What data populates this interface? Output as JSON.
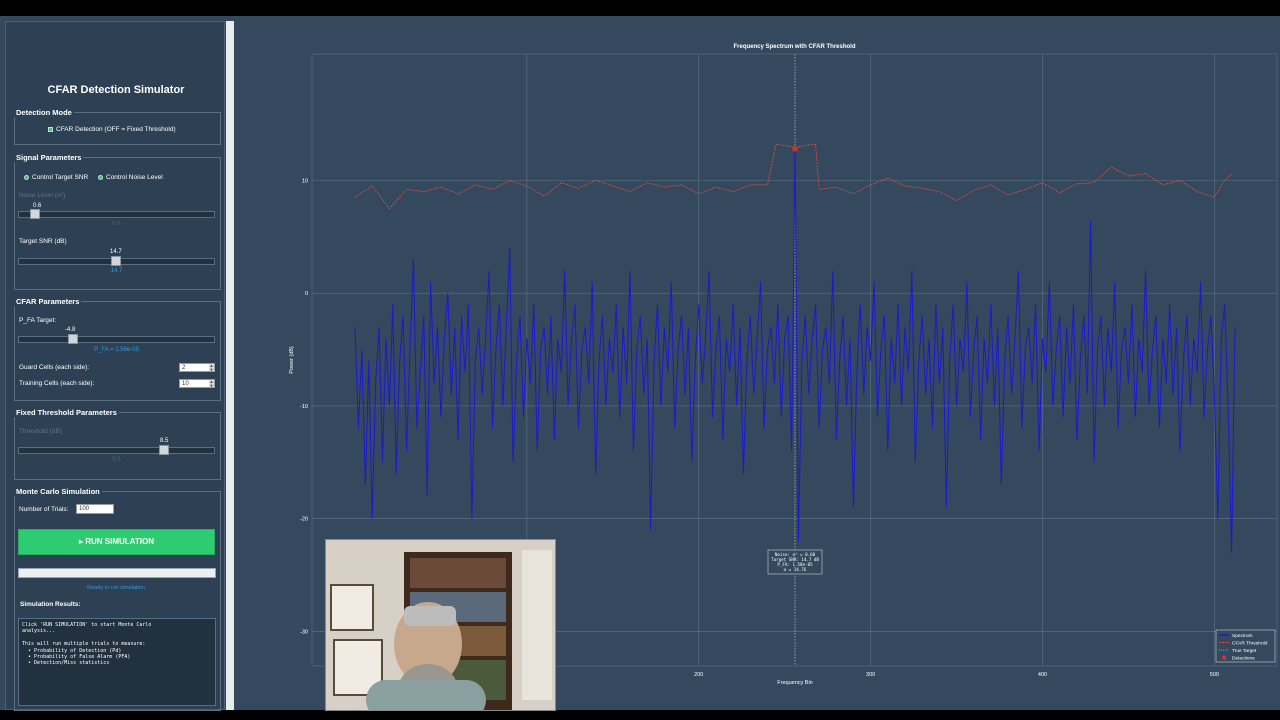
{
  "sidebar": {
    "title": "CFAR Detection Simulator",
    "detection_mode": {
      "title": "Detection Mode",
      "cfar_checkbox_label": "CFAR Detection (OFF = Fixed Threshold)",
      "cfar_checked": true
    },
    "signal": {
      "title": "Signal Parameters",
      "radio_snr_label": "Control Target SNR",
      "radio_noise_label": "Control Noise Level",
      "noise_label": "Noise Level (σ²)",
      "noise_value": "0.6",
      "noise_value_below": "0.6",
      "noise_fraction": 0.06,
      "snr_label": "Target SNR (dB)",
      "snr_value": "14.7",
      "snr_value_below": "14.7",
      "snr_fraction": 0.49
    },
    "cfar": {
      "title": "CFAR Parameters",
      "pfa_label": "P_FA Target:",
      "pfa_value": "-4.8",
      "pfa_display": "P_FA = 1.58e-05",
      "pfa_fraction": 0.26,
      "guard_label": "Guard Cells (each side):",
      "guard_value": "2",
      "training_label": "Training Cells (each side):",
      "training_value": "10"
    },
    "fixed": {
      "title": "Fixed Threshold Parameters",
      "threshold_label": "Threshold (dB)",
      "threshold_value": "8.5",
      "threshold_value_below": "8.5",
      "threshold_fraction": 0.75
    },
    "monte_carlo": {
      "title": "Monte Carlo Simulation",
      "trials_label": "Number of Trials:",
      "trials_value": "100",
      "run_label": "▸ RUN SIMULATION",
      "status": "Ready to run simulation",
      "results_title": "Simulation Results:",
      "results_text": "Click 'RUN SIMULATION' to start Monte Carlo\nanalysis...\n\nThis will run multiple trials to measure:\n  • Probability of Detection (Pd)\n  • Probability of False Alarm (PFA)\n  • Detection/Miss statistics"
    }
  },
  "chart_data": {
    "type": "line",
    "title": "Frequency Spectrum with CFAR Threshold",
    "xlabel": "Frequency Bin",
    "ylabel": "Power (dB)",
    "xlim": [
      0,
      512
    ],
    "ylim": [
      -32,
      15
    ],
    "x_ticks": [
      200,
      300,
      400,
      500
    ],
    "y_ticks": [
      10,
      0,
      -10,
      -20,
      -30
    ],
    "grid": true,
    "legend": [
      "Spectrum",
      "CFAR Threshold",
      "True Target",
      "Detections"
    ],
    "legend_position": "bottom-right",
    "true_target_bin": 256,
    "detection_bin": 256,
    "detection_value": 12.8,
    "annotation": "Noise: σ² = 0.60\nTarget SNR: 14.7 dB\nP_FA: 1.58e-05\nα = 14.76",
    "series_colors": {
      "Spectrum": "#1a1acd",
      "CFAR Threshold": "#e74c3c",
      "True Target": "#aab4be",
      "Detections": "#c0392b"
    },
    "threshold_points": [
      [
        0,
        8.5
      ],
      [
        10,
        9.5
      ],
      [
        20,
        7.5
      ],
      [
        30,
        9.2
      ],
      [
        40,
        9.0
      ],
      [
        50,
        9.4
      ],
      [
        60,
        8.8
      ],
      [
        70,
        9.6
      ],
      [
        80,
        9.2
      ],
      [
        90,
        10.0
      ],
      [
        100,
        9.5
      ],
      [
        110,
        8.6
      ],
      [
        120,
        9.8
      ],
      [
        130,
        9.3
      ],
      [
        140,
        10.0
      ],
      [
        150,
        9.5
      ],
      [
        160,
        9.0
      ],
      [
        170,
        9.8
      ],
      [
        180,
        9.4
      ],
      [
        190,
        9.6
      ],
      [
        200,
        8.8
      ],
      [
        210,
        9.4
      ],
      [
        220,
        9.0
      ],
      [
        230,
        9.6
      ],
      [
        240,
        9.6
      ],
      [
        245,
        13.2
      ],
      [
        250,
        13.1
      ],
      [
        256,
        12.9
      ],
      [
        262,
        13.1
      ],
      [
        268,
        13.2
      ],
      [
        270,
        9.2
      ],
      [
        280,
        9.4
      ],
      [
        290,
        8.8
      ],
      [
        300,
        9.6
      ],
      [
        310,
        10.2
      ],
      [
        320,
        9.5
      ],
      [
        330,
        9.3
      ],
      [
        340,
        9.0
      ],
      [
        350,
        8.2
      ],
      [
        360,
        9.1
      ],
      [
        370,
        9.6
      ],
      [
        380,
        8.7
      ],
      [
        390,
        9.2
      ],
      [
        400,
        9.8
      ],
      [
        410,
        8.9
      ],
      [
        420,
        9.7
      ],
      [
        430,
        9.8
      ],
      [
        440,
        11.2
      ],
      [
        450,
        10.4
      ],
      [
        460,
        10.6
      ],
      [
        470,
        9.6
      ],
      [
        480,
        10.0
      ],
      [
        490,
        9.0
      ],
      [
        500,
        8.5
      ],
      [
        505,
        9.8
      ],
      [
        510,
        10.6
      ]
    ],
    "spectrum_points": [
      [
        0,
        -3
      ],
      [
        2,
        -12
      ],
      [
        4,
        -5
      ],
      [
        6,
        -17
      ],
      [
        8,
        -6
      ],
      [
        10,
        -20
      ],
      [
        12,
        -8
      ],
      [
        14,
        -3
      ],
      [
        16,
        -15
      ],
      [
        18,
        -4
      ],
      [
        20,
        -10
      ],
      [
        22,
        -1
      ],
      [
        24,
        -16
      ],
      [
        26,
        -6
      ],
      [
        28,
        -2
      ],
      [
        30,
        -14
      ],
      [
        32,
        -5
      ],
      [
        34,
        3
      ],
      [
        36,
        -12
      ],
      [
        38,
        -7
      ],
      [
        40,
        -2
      ],
      [
        42,
        -18
      ],
      [
        44,
        1
      ],
      [
        46,
        -8
      ],
      [
        48,
        -3
      ],
      [
        50,
        -11
      ],
      [
        52,
        -4
      ],
      [
        54,
        0
      ],
      [
        56,
        -9
      ],
      [
        58,
        -3
      ],
      [
        60,
        -13
      ],
      [
        62,
        -2
      ],
      [
        64,
        -7
      ],
      [
        66,
        -1
      ],
      [
        68,
        -20
      ],
      [
        70,
        -6
      ],
      [
        72,
        -3
      ],
      [
        74,
        -9
      ],
      [
        76,
        -4
      ],
      [
        78,
        2
      ],
      [
        80,
        -12
      ],
      [
        82,
        -5
      ],
      [
        84,
        -1
      ],
      [
        86,
        -10
      ],
      [
        88,
        -3
      ],
      [
        90,
        4
      ],
      [
        92,
        -15
      ],
      [
        94,
        -6
      ],
      [
        96,
        -2
      ],
      [
        98,
        -11
      ],
      [
        100,
        -4
      ],
      [
        102,
        -8
      ],
      [
        104,
        -1
      ],
      [
        106,
        -14
      ],
      [
        108,
        -5
      ],
      [
        110,
        -3
      ],
      [
        112,
        -9
      ],
      [
        114,
        -2
      ],
      [
        116,
        -13
      ],
      [
        118,
        -4
      ],
      [
        120,
        -7
      ],
      [
        122,
        2
      ],
      [
        124,
        -10
      ],
      [
        126,
        -4
      ],
      [
        128,
        -1
      ],
      [
        130,
        -12
      ],
      [
        132,
        -5
      ],
      [
        134,
        -3
      ],
      [
        136,
        -8
      ],
      [
        138,
        1
      ],
      [
        140,
        -16
      ],
      [
        142,
        -6
      ],
      [
        144,
        -2
      ],
      [
        146,
        -10
      ],
      [
        148,
        -4
      ],
      [
        150,
        -7
      ],
      [
        152,
        -1
      ],
      [
        154,
        -11
      ],
      [
        156,
        -3
      ],
      [
        158,
        -8
      ],
      [
        160,
        2
      ],
      [
        162,
        -14
      ],
      [
        164,
        -5
      ],
      [
        166,
        -2
      ],
      [
        168,
        -9
      ],
      [
        170,
        -4
      ],
      [
        172,
        -21
      ],
      [
        174,
        -6
      ],
      [
        176,
        -1
      ],
      [
        178,
        -10
      ],
      [
        180,
        -3
      ],
      [
        182,
        -7
      ],
      [
        184,
        1
      ],
      [
        186,
        -12
      ],
      [
        188,
        -5
      ],
      [
        190,
        -2
      ],
      [
        192,
        -9
      ],
      [
        194,
        -3
      ],
      [
        196,
        -15
      ],
      [
        198,
        -6
      ],
      [
        200,
        -1
      ],
      [
        202,
        -8
      ],
      [
        204,
        -4
      ],
      [
        206,
        2
      ],
      [
        208,
        -11
      ],
      [
        210,
        -5
      ],
      [
        212,
        -2
      ],
      [
        214,
        -13
      ],
      [
        216,
        -4
      ],
      [
        218,
        -7
      ],
      [
        220,
        -1
      ],
      [
        222,
        -10
      ],
      [
        224,
        -3
      ],
      [
        226,
        -16
      ],
      [
        228,
        -6
      ],
      [
        230,
        -2
      ],
      [
        232,
        -9
      ],
      [
        234,
        -4
      ],
      [
        236,
        1
      ],
      [
        238,
        -12
      ],
      [
        240,
        -5
      ],
      [
        242,
        -3
      ],
      [
        244,
        -8
      ],
      [
        246,
        -1
      ],
      [
        248,
        -11
      ],
      [
        250,
        -4
      ],
      [
        252,
        -2
      ],
      [
        254,
        -14
      ],
      [
        256,
        12.8
      ],
      [
        258,
        -22
      ],
      [
        260,
        -6
      ],
      [
        262,
        -2
      ],
      [
        264,
        -9
      ],
      [
        266,
        -4
      ],
      [
        268,
        -1
      ],
      [
        270,
        -12
      ],
      [
        272,
        -5
      ],
      [
        274,
        -3
      ],
      [
        276,
        -8
      ],
      [
        278,
        2
      ],
      [
        280,
        -13
      ],
      [
        282,
        -6
      ],
      [
        284,
        -2
      ],
      [
        286,
        -10
      ],
      [
        288,
        -4
      ],
      [
        290,
        -19
      ],
      [
        292,
        -7
      ],
      [
        294,
        -1
      ],
      [
        296,
        -9
      ],
      [
        298,
        -3
      ],
      [
        300,
        -6
      ],
      [
        302,
        1
      ],
      [
        304,
        -11
      ],
      [
        306,
        -5
      ],
      [
        308,
        -2
      ],
      [
        310,
        -14
      ],
      [
        312,
        -4
      ],
      [
        314,
        -8
      ],
      [
        316,
        -1
      ],
      [
        318,
        -10
      ],
      [
        320,
        -3
      ],
      [
        322,
        -7
      ],
      [
        324,
        2
      ],
      [
        326,
        -15
      ],
      [
        328,
        -6
      ],
      [
        330,
        -2
      ],
      [
        332,
        -9
      ],
      [
        334,
        -4
      ],
      [
        336,
        -12
      ],
      [
        338,
        -1
      ],
      [
        340,
        -8
      ],
      [
        342,
        -3
      ],
      [
        344,
        -19
      ],
      [
        346,
        -6
      ],
      [
        348,
        -1
      ],
      [
        350,
        -10
      ],
      [
        352,
        -4
      ],
      [
        354,
        -7
      ],
      [
        356,
        1
      ],
      [
        358,
        -11
      ],
      [
        360,
        -5
      ],
      [
        362,
        -2
      ],
      [
        364,
        -13
      ],
      [
        366,
        -4
      ],
      [
        368,
        -8
      ],
      [
        370,
        -1
      ],
      [
        372,
        -10
      ],
      [
        374,
        -3
      ],
      [
        376,
        -17
      ],
      [
        378,
        -6
      ],
      [
        380,
        -2
      ],
      [
        382,
        -9
      ],
      [
        384,
        -4
      ],
      [
        386,
        2
      ],
      [
        388,
        -12
      ],
      [
        390,
        -5
      ],
      [
        392,
        -3
      ],
      [
        394,
        -8
      ],
      [
        396,
        -1
      ],
      [
        398,
        -14
      ],
      [
        400,
        -4
      ],
      [
        402,
        -7
      ],
      [
        404,
        1
      ],
      [
        406,
        -10
      ],
      [
        408,
        -5
      ],
      [
        410,
        -2
      ],
      [
        412,
        -11
      ],
      [
        414,
        -3
      ],
      [
        416,
        -8
      ],
      [
        418,
        -1
      ],
      [
        420,
        -13
      ],
      [
        422,
        -6
      ],
      [
        424,
        -2
      ],
      [
        426,
        -9
      ],
      [
        428,
        6.5
      ],
      [
        430,
        -15
      ],
      [
        432,
        -5
      ],
      [
        434,
        -2
      ],
      [
        436,
        -10
      ],
      [
        438,
        -3
      ],
      [
        440,
        -7
      ],
      [
        442,
        1
      ],
      [
        444,
        -12
      ],
      [
        446,
        -5
      ],
      [
        448,
        -3
      ],
      [
        450,
        -8
      ],
      [
        452,
        -1
      ],
      [
        454,
        -11
      ],
      [
        456,
        -4
      ],
      [
        458,
        -7
      ],
      [
        460,
        2
      ],
      [
        462,
        -10
      ],
      [
        464,
        -5
      ],
      [
        466,
        -2
      ],
      [
        468,
        -12
      ],
      [
        470,
        -4
      ],
      [
        472,
        -8
      ],
      [
        474,
        -1
      ],
      [
        476,
        -9
      ],
      [
        478,
        -3
      ],
      [
        480,
        -14
      ],
      [
        482,
        -6
      ],
      [
        484,
        -2
      ],
      [
        486,
        -10
      ],
      [
        488,
        -4
      ],
      [
        490,
        -7
      ],
      [
        492,
        1
      ],
      [
        494,
        -11
      ],
      [
        496,
        -5
      ],
      [
        498,
        -2
      ],
      [
        500,
        -9
      ],
      [
        502,
        -20
      ],
      [
        504,
        -4
      ],
      [
        506,
        -1
      ],
      [
        508,
        -10
      ],
      [
        510,
        -23
      ],
      [
        512,
        -3
      ]
    ]
  }
}
